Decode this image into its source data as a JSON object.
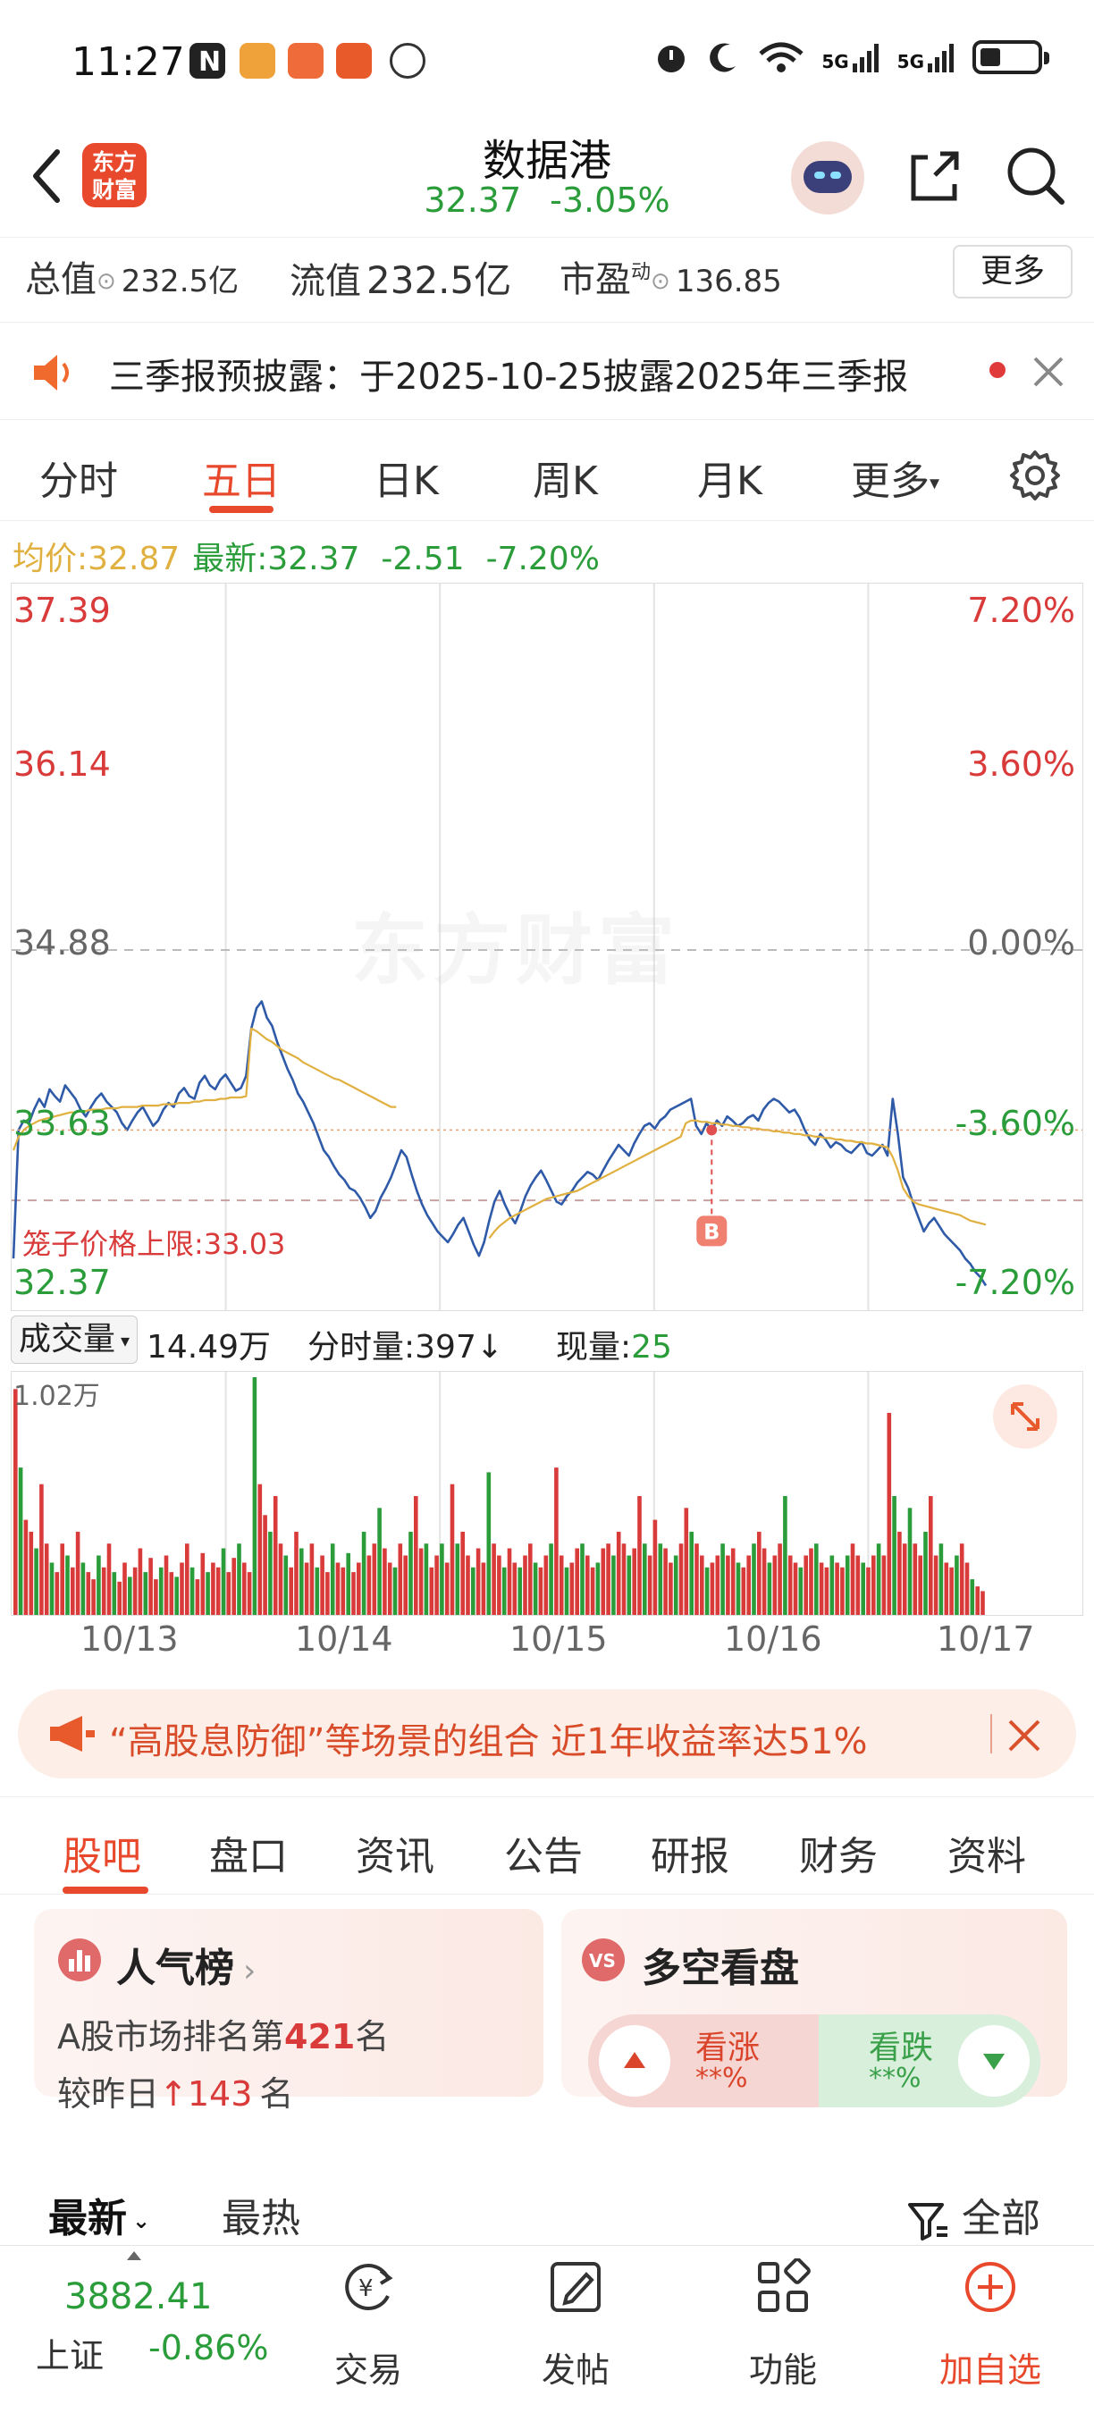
{
  "status_bar": {
    "time": "11:27",
    "network_1": "5G",
    "network_2": "5G",
    "battery_level": 0.35
  },
  "header": {
    "logo_line1": "东方",
    "logo_line2": "财富",
    "stock_name": "数据港",
    "price": "32.37",
    "change_pct": "-3.05%"
  },
  "stats": {
    "total_value_label": "总值",
    "total_value": "232.5亿",
    "float_value_label": "流值",
    "float_value": "232.5亿",
    "pe_label": "市盈",
    "pe_superscript": "动",
    "pe_value": "136.85",
    "more_button": "更多"
  },
  "notice": {
    "text": "三季报预披露：于2025-10-25披露2025年三季报"
  },
  "chart_tabs": {
    "items": [
      "分时",
      "五日",
      "日K",
      "周K",
      "月K",
      "更多"
    ],
    "active_index": 1
  },
  "info_line": {
    "avg_label": "均价:",
    "avg_value": "32.87",
    "latest_label": "最新:",
    "latest_value": "32.37",
    "change": "-2.51",
    "change_pct": "-7.20%"
  },
  "chart_data": {
    "type": "line",
    "x_labels": [
      "10/13",
      "10/14",
      "10/15",
      "10/16",
      "10/17"
    ],
    "y_ticks_left": [
      "37.39",
      "36.14",
      "34.88",
      "33.63",
      "32.37"
    ],
    "y_ticks_right": [
      "7.20%",
      "3.60%",
      "0.00%",
      "-3.60%",
      "-7.20%"
    ],
    "ylim": [
      32.37,
      37.39
    ],
    "reference_price": 34.88,
    "cage_label": "笼子价格上限:",
    "cage_value": "33.03",
    "cage_price": 33.03,
    "buy_marker": "B",
    "watermark": "东方财富",
    "series": [
      {
        "name": "价格",
        "color": "#2f5aa8",
        "values": [
          32.6,
          33.55,
          33.62,
          33.6,
          33.7,
          33.78,
          33.72,
          33.85,
          33.8,
          33.76,
          33.88,
          33.83,
          33.78,
          33.7,
          33.65,
          33.72,
          33.78,
          33.82,
          33.76,
          33.72,
          33.68,
          33.6,
          33.55,
          33.62,
          33.68,
          33.72,
          33.65,
          33.58,
          33.62,
          33.7,
          33.75,
          33.72,
          33.82,
          33.86,
          33.8,
          33.78,
          33.9,
          33.95,
          33.88,
          33.85,
          33.92,
          33.96,
          33.9,
          33.84,
          33.86,
          33.95,
          34.3,
          34.45,
          34.5,
          34.38,
          34.32,
          34.2,
          34.1,
          34.0,
          33.92,
          33.82,
          33.76,
          33.68,
          33.6,
          33.5,
          33.4,
          33.35,
          33.28,
          33.22,
          33.18,
          33.12,
          33.1,
          33.05,
          32.98,
          32.9,
          32.95,
          33.05,
          33.12,
          33.2,
          33.3,
          33.4,
          33.35,
          33.22,
          33.1,
          33.0,
          32.92,
          32.86,
          32.8,
          32.76,
          32.72,
          32.78,
          32.85,
          32.9,
          32.8,
          32.7,
          32.62,
          32.72,
          32.88,
          33.02,
          33.1,
          33.0,
          32.92,
          32.86,
          32.95,
          33.06,
          33.14,
          33.2,
          33.25,
          33.18,
          33.1,
          33.02,
          33.0,
          33.06,
          33.1,
          33.16,
          33.2,
          33.24,
          33.22,
          33.18,
          33.25,
          33.32,
          33.38,
          33.44,
          33.4,
          33.36,
          33.45,
          33.52,
          33.58,
          33.6,
          33.56,
          33.62,
          33.65,
          33.7,
          33.72,
          33.74,
          33.76,
          33.78,
          33.58,
          33.52,
          33.6,
          33.55,
          33.62,
          33.58,
          33.65,
          33.62,
          33.58,
          33.6,
          33.64,
          33.66,
          33.62,
          33.7,
          33.75,
          33.78,
          33.76,
          33.72,
          33.68,
          33.7,
          33.64,
          33.55,
          33.48,
          33.44,
          33.52,
          33.48,
          33.42,
          33.46,
          33.44,
          33.4,
          33.38,
          33.42,
          33.46,
          33.38,
          33.36,
          33.4,
          33.44,
          33.36,
          33.78,
          33.52,
          33.2,
          33.12,
          33.0,
          32.9,
          32.8,
          32.86,
          32.9,
          32.84,
          32.78,
          32.74,
          32.7,
          32.66,
          32.6,
          32.56,
          32.5,
          32.46,
          32.4
        ]
      },
      {
        "name": "均价",
        "color": "#e0b040",
        "values": [
          33.4,
          33.5,
          33.55,
          33.58,
          33.6,
          33.62,
          33.63,
          33.64,
          33.65,
          33.66,
          33.67,
          33.68,
          33.68,
          33.69,
          33.69,
          33.7,
          33.7,
          33.7,
          33.71,
          33.71,
          33.71,
          33.72,
          33.72,
          33.72,
          33.72,
          33.73,
          33.73,
          33.73,
          33.73,
          33.74,
          33.74,
          33.74,
          33.75,
          33.75,
          33.75,
          33.76,
          33.76,
          33.77,
          33.77,
          33.77,
          33.78,
          33.78,
          33.79,
          33.79,
          33.79,
          33.8,
          34.3,
          34.28,
          34.25,
          34.22,
          34.2,
          34.17,
          34.14,
          34.12,
          34.1,
          34.08,
          34.05,
          34.03,
          34.01,
          33.99,
          33.97,
          33.95,
          33.93,
          33.92,
          33.9,
          33.88,
          33.86,
          33.84,
          33.82,
          33.8,
          33.78,
          33.76,
          33.74,
          33.72,
          33.72,
          null,
          null,
          null,
          null,
          null,
          null,
          null,
          null,
          null,
          null,
          null,
          null,
          null,
          null,
          null,
          null,
          null,
          32.75,
          32.8,
          32.84,
          32.87,
          32.9,
          32.92,
          32.94,
          32.96,
          32.98,
          33.0,
          33.02,
          33.04,
          33.05,
          33.06,
          33.07,
          33.08,
          33.09,
          33.1,
          33.12,
          33.14,
          33.16,
          33.18,
          33.2,
          33.22,
          33.24,
          33.26,
          33.28,
          33.3,
          33.32,
          33.34,
          33.36,
          33.38,
          33.4,
          33.42,
          33.44,
          33.46,
          33.48,
          33.5,
          33.6,
          33.62,
          33.62,
          33.61,
          33.61,
          33.6,
          33.6,
          33.59,
          33.59,
          33.58,
          33.58,
          33.57,
          33.57,
          33.56,
          33.56,
          33.55,
          33.55,
          33.54,
          33.54,
          33.53,
          33.53,
          33.52,
          33.52,
          33.51,
          33.51,
          33.5,
          33.5,
          33.49,
          33.49,
          33.48,
          33.48,
          33.47,
          33.47,
          33.46,
          33.46,
          33.45,
          33.45,
          33.44,
          33.43,
          33.42,
          33.35,
          33.25,
          33.12,
          33.06,
          33.02,
          33.0,
          32.99,
          32.98,
          32.97,
          32.96,
          32.95,
          32.94,
          32.93,
          32.92,
          32.9,
          32.88,
          32.87,
          32.86,
          32.85
        ]
      }
    ]
  },
  "volume": {
    "selector_label": "成交量",
    "total": "14.49万",
    "tick_label": "分时量:397",
    "tick_arrow": "↓",
    "current_label": "现量:",
    "current_value": "25",
    "max_label": "1.02万",
    "bars": [
      0.95,
      0.62,
      0.4,
      0.35,
      0.28,
      0.55,
      0.3,
      0.22,
      0.18,
      0.3,
      0.25,
      0.2,
      0.35,
      0.22,
      0.18,
      0.15,
      0.25,
      0.2,
      0.3,
      0.18,
      0.14,
      0.22,
      0.16,
      0.2,
      0.28,
      0.18,
      0.24,
      0.15,
      0.2,
      0.25,
      0.18,
      0.16,
      0.22,
      0.3,
      0.2,
      0.15,
      0.26,
      0.18,
      0.22,
      0.2,
      0.28,
      0.18,
      0.24,
      0.3,
      0.22,
      0.18,
      1.0,
      0.55,
      0.42,
      0.35,
      0.5,
      0.3,
      0.25,
      0.2,
      0.35,
      0.28,
      0.22,
      0.3,
      0.2,
      0.25,
      0.18,
      0.3,
      0.22,
      0.2,
      0.26,
      0.18,
      0.22,
      0.35,
      0.25,
      0.3,
      0.45,
      0.28,
      0.22,
      0.2,
      0.3,
      0.25,
      0.35,
      0.5,
      0.28,
      0.3,
      0.2,
      0.25,
      0.3,
      0.22,
      0.55,
      0.3,
      0.35,
      0.25,
      0.2,
      0.28,
      0.22,
      0.6,
      0.3,
      0.25,
      0.2,
      0.28,
      0.22,
      0.2,
      0.25,
      0.3,
      0.22,
      0.2,
      0.25,
      0.3,
      0.62,
      0.25,
      0.2,
      0.22,
      0.28,
      0.3,
      0.25,
      0.2,
      0.22,
      0.28,
      0.3,
      0.25,
      0.35,
      0.3,
      0.25,
      0.28,
      0.5,
      0.3,
      0.25,
      0.4,
      0.3,
      0.28,
      0.22,
      0.25,
      0.3,
      0.45,
      0.35,
      0.3,
      0.25,
      0.2,
      0.22,
      0.25,
      0.3,
      0.25,
      0.28,
      0.22,
      0.2,
      0.25,
      0.3,
      0.35,
      0.28,
      0.22,
      0.25,
      0.3,
      0.5,
      0.25,
      0.22,
      0.2,
      0.25,
      0.28,
      0.3,
      0.22,
      0.2,
      0.25,
      0.22,
      0.2,
      0.25,
      0.3,
      0.25,
      0.22,
      0.2,
      0.25,
      0.3,
      0.25,
      0.85,
      0.5,
      0.35,
      0.3,
      0.45,
      0.3,
      0.25,
      0.35,
      0.5,
      0.25,
      0.3,
      0.22,
      0.2,
      0.25,
      0.3,
      0.22,
      0.15,
      0.12,
      0.1
    ]
  },
  "banner": {
    "text": "“高股息防御”等场景的组合 近1年收益率达51%"
  },
  "content_tabs": {
    "items": [
      "股吧",
      "盘口",
      "资讯",
      "公告",
      "研报",
      "财务",
      "资料"
    ],
    "active_index": 0
  },
  "popularity_card": {
    "title": "人气榜",
    "rank_prefix": "A股市场排名第",
    "rank_value": "421",
    "rank_suffix": "名",
    "change_prefix": "较昨日",
    "change_value": "143",
    "change_suffix": "名"
  },
  "sentiment_card": {
    "title": "多空看盘",
    "bull_label": "看涨",
    "bull_value": "**%",
    "bear_label": "看跌",
    "bear_value": "**%"
  },
  "sort_bar": {
    "latest": "最新",
    "hot": "最热",
    "filter": "全部"
  },
  "bottom_nav": {
    "index_value": "3882.41",
    "index_name": "上证",
    "index_change": "-0.86%",
    "trade": "交易",
    "post": "发帖",
    "functions": "功能",
    "add_watchlist": "加自选",
    "trade_symbol": "¥"
  },
  "colors": {
    "brand": "#e8492c",
    "up": "#d93a3a",
    "down": "#2a9d3a",
    "price_line": "#2f5aa8",
    "avg_line": "#e0b040"
  }
}
